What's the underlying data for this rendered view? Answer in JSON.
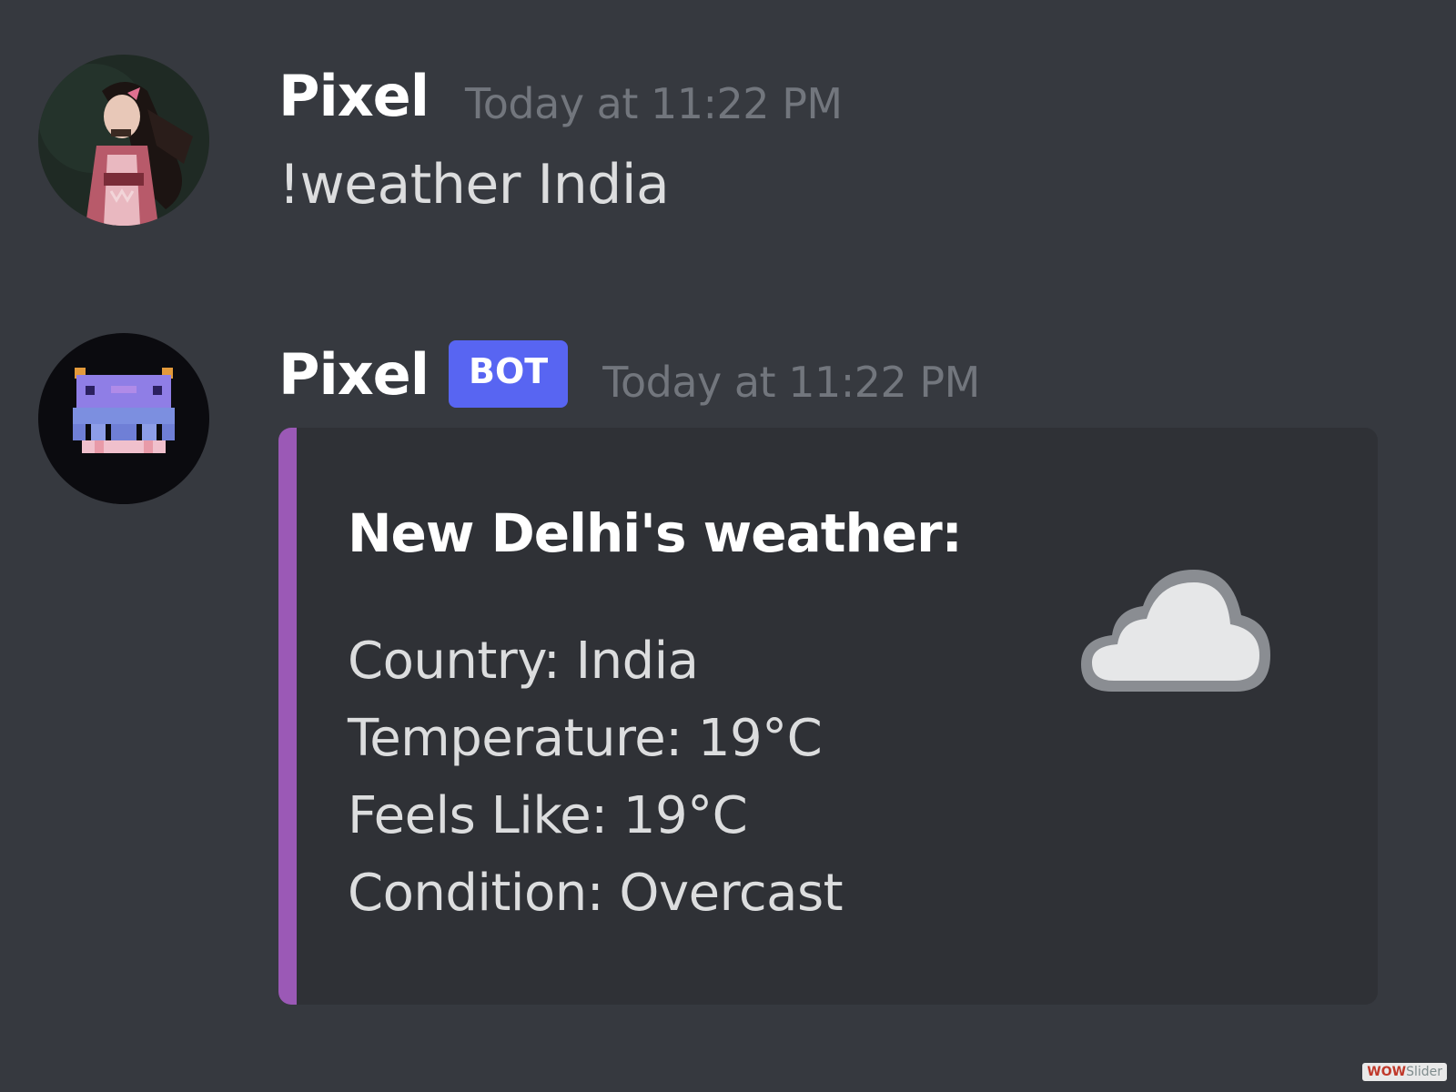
{
  "messages": [
    {
      "author": "Pixel",
      "timestamp": "Today at 11:22 PM",
      "text": "!weather India",
      "avatar_icon": "anime-girl-avatar"
    },
    {
      "author": "Pixel",
      "badge": "BOT",
      "timestamp": "Today at 11:22 PM",
      "avatar_icon": "pixel-creature-avatar",
      "embed": {
        "accent_color": "#9b59b6",
        "title": "New Delhi's weather:",
        "fields": [
          "Country: India",
          "Temperature: 19°C",
          "Feels Like: 19°C",
          "Condition: Overcast"
        ],
        "thumbnail_icon": "cloud-icon"
      }
    }
  ],
  "watermark": {
    "part1": "WOW",
    "part2": "Slider"
  },
  "colors": {
    "background": "#36393f",
    "embed_background": "#2f3136",
    "bot_badge": "#5865f2",
    "timestamp": "#72767d"
  }
}
